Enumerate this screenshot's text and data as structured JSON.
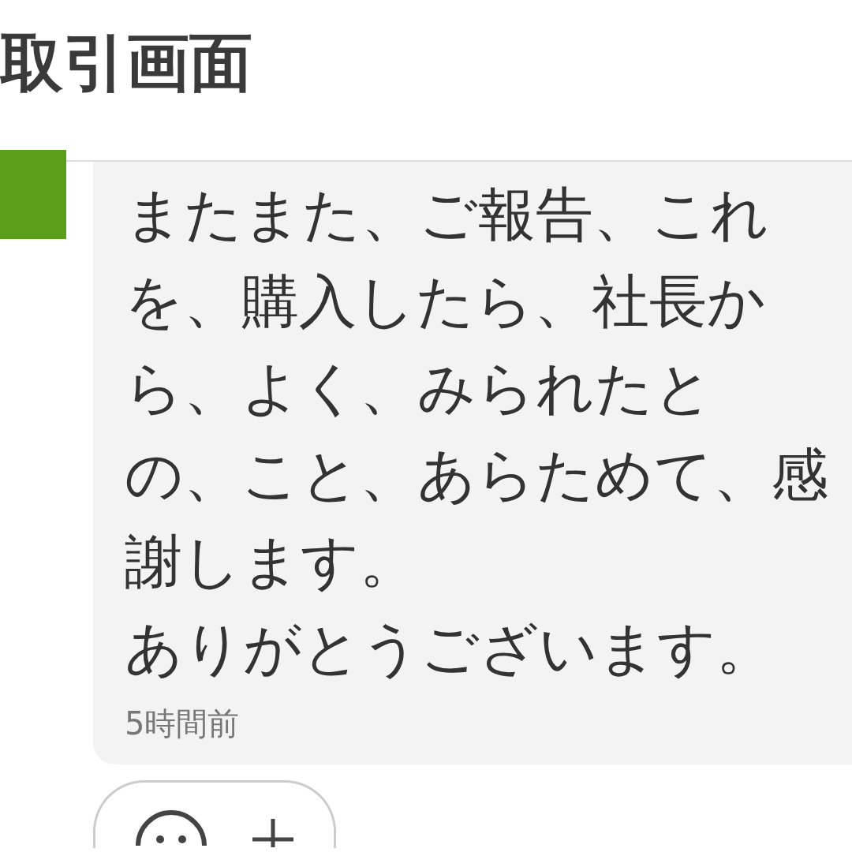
{
  "title": "取引画面",
  "message": {
    "paragraphs": [
      "またまた、ご報告、これを、購入したら、社長から、よく、みられたとの、こと、あらためて、感謝します。",
      "ありがとうございます。"
    ],
    "time": "5時間前"
  }
}
